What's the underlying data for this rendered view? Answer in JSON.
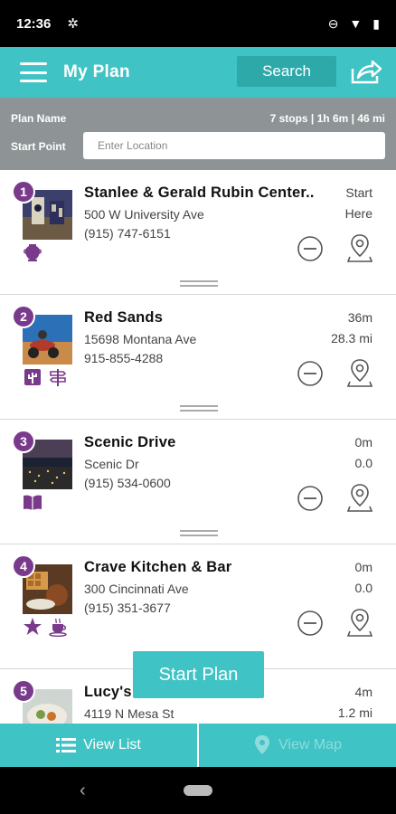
{
  "status": {
    "time": "12:36"
  },
  "header": {
    "title": "My Plan",
    "search_label": "Search"
  },
  "plan": {
    "name_label": "Plan Name",
    "stats": "7 stops | 1h 6m | 46 mi",
    "start_label": "Start Point",
    "start_placeholder": "Enter Location"
  },
  "stops": [
    {
      "num": "1",
      "name": "Stanlee & Gerald Rubin Center..",
      "address": "500 W University Ave",
      "phone": "(915) 747-6151",
      "right1": "Start",
      "right2": "Here",
      "categories": [
        "vase-icon"
      ]
    },
    {
      "num": "2",
      "name": "Red Sands",
      "address": "15698 Montana Ave",
      "phone": "915-855-4288",
      "right1": "36m",
      "right2": "28.3 mi",
      "categories": [
        "cactus-icon",
        "signpost-icon"
      ]
    },
    {
      "num": "3",
      "name": "Scenic Drive",
      "address": "Scenic Dr",
      "phone": "(915) 534-0600",
      "right1": "0m",
      "right2": "0.0",
      "categories": [
        "book-icon"
      ]
    },
    {
      "num": "4",
      "name": "Crave Kitchen & Bar",
      "address": "300 Cincinnati Ave",
      "phone": "(915) 351-3677",
      "right1": "0m",
      "right2": "0.0",
      "categories": [
        "star-icon",
        "coffee-icon"
      ]
    },
    {
      "num": "5",
      "name": "Lucy's Restaurant",
      "address": "4119 N Mesa St",
      "phone": "",
      "right1": "4m",
      "right2": "1.2 mi",
      "categories": []
    }
  ],
  "start_plan_label": "Start Plan",
  "tabs": {
    "list": "View List",
    "map": "View Map"
  },
  "colors": {
    "teal": "#3fc3c4",
    "purple": "#7a3a8c",
    "gray_bar": "#8e9495"
  }
}
